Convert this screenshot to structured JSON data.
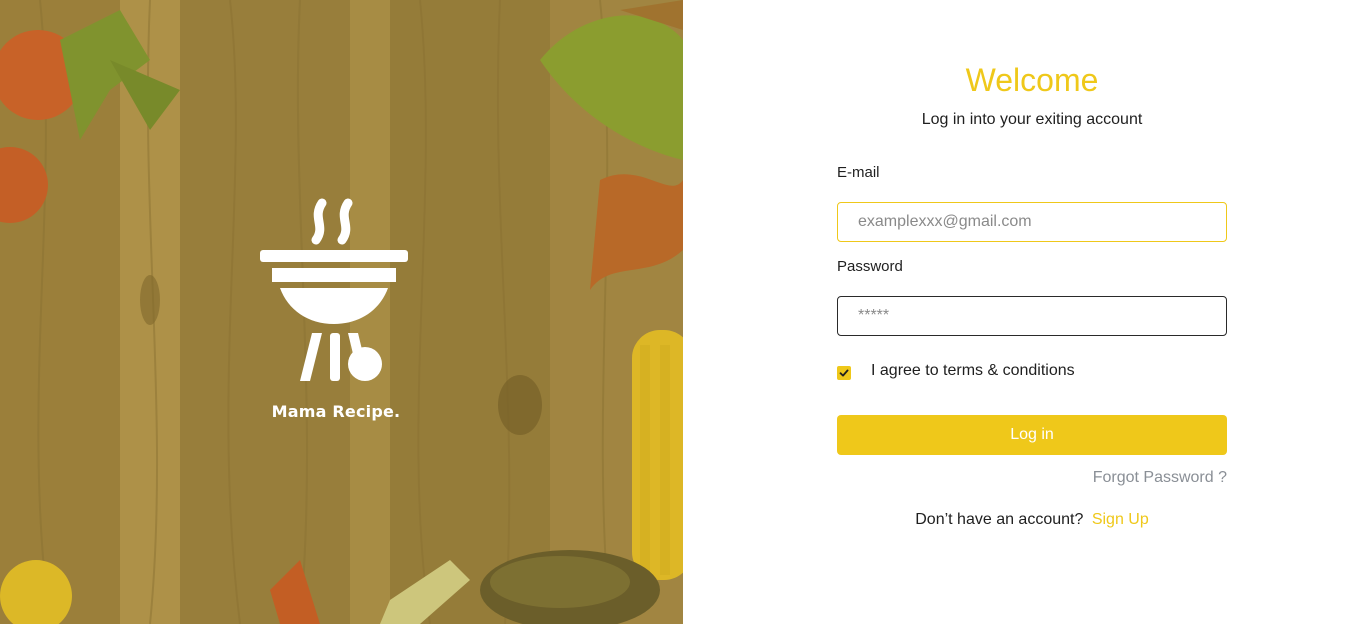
{
  "brand": {
    "name": "Mama Recipe.",
    "logo_icon": "grill-icon"
  },
  "form": {
    "title": "Welcome",
    "subtitle": "Log in into your exiting account",
    "email": {
      "label": "E-mail",
      "placeholder": "examplexxx@gmail.com",
      "value": ""
    },
    "password": {
      "label": "Password",
      "placeholder": "*****",
      "value": ""
    },
    "terms": {
      "label": "I agree to terms & conditions",
      "checked": true
    },
    "login_label": "Log in",
    "forgot_label": "Forgot Password ?",
    "signup_prompt": "Don’t have an account?",
    "signup_label": "Sign Up"
  },
  "colors": {
    "accent": "#efc81a",
    "text": "#1f1f1f",
    "muted": "#8a8f96",
    "hero_overlay": "#c9a23a"
  }
}
